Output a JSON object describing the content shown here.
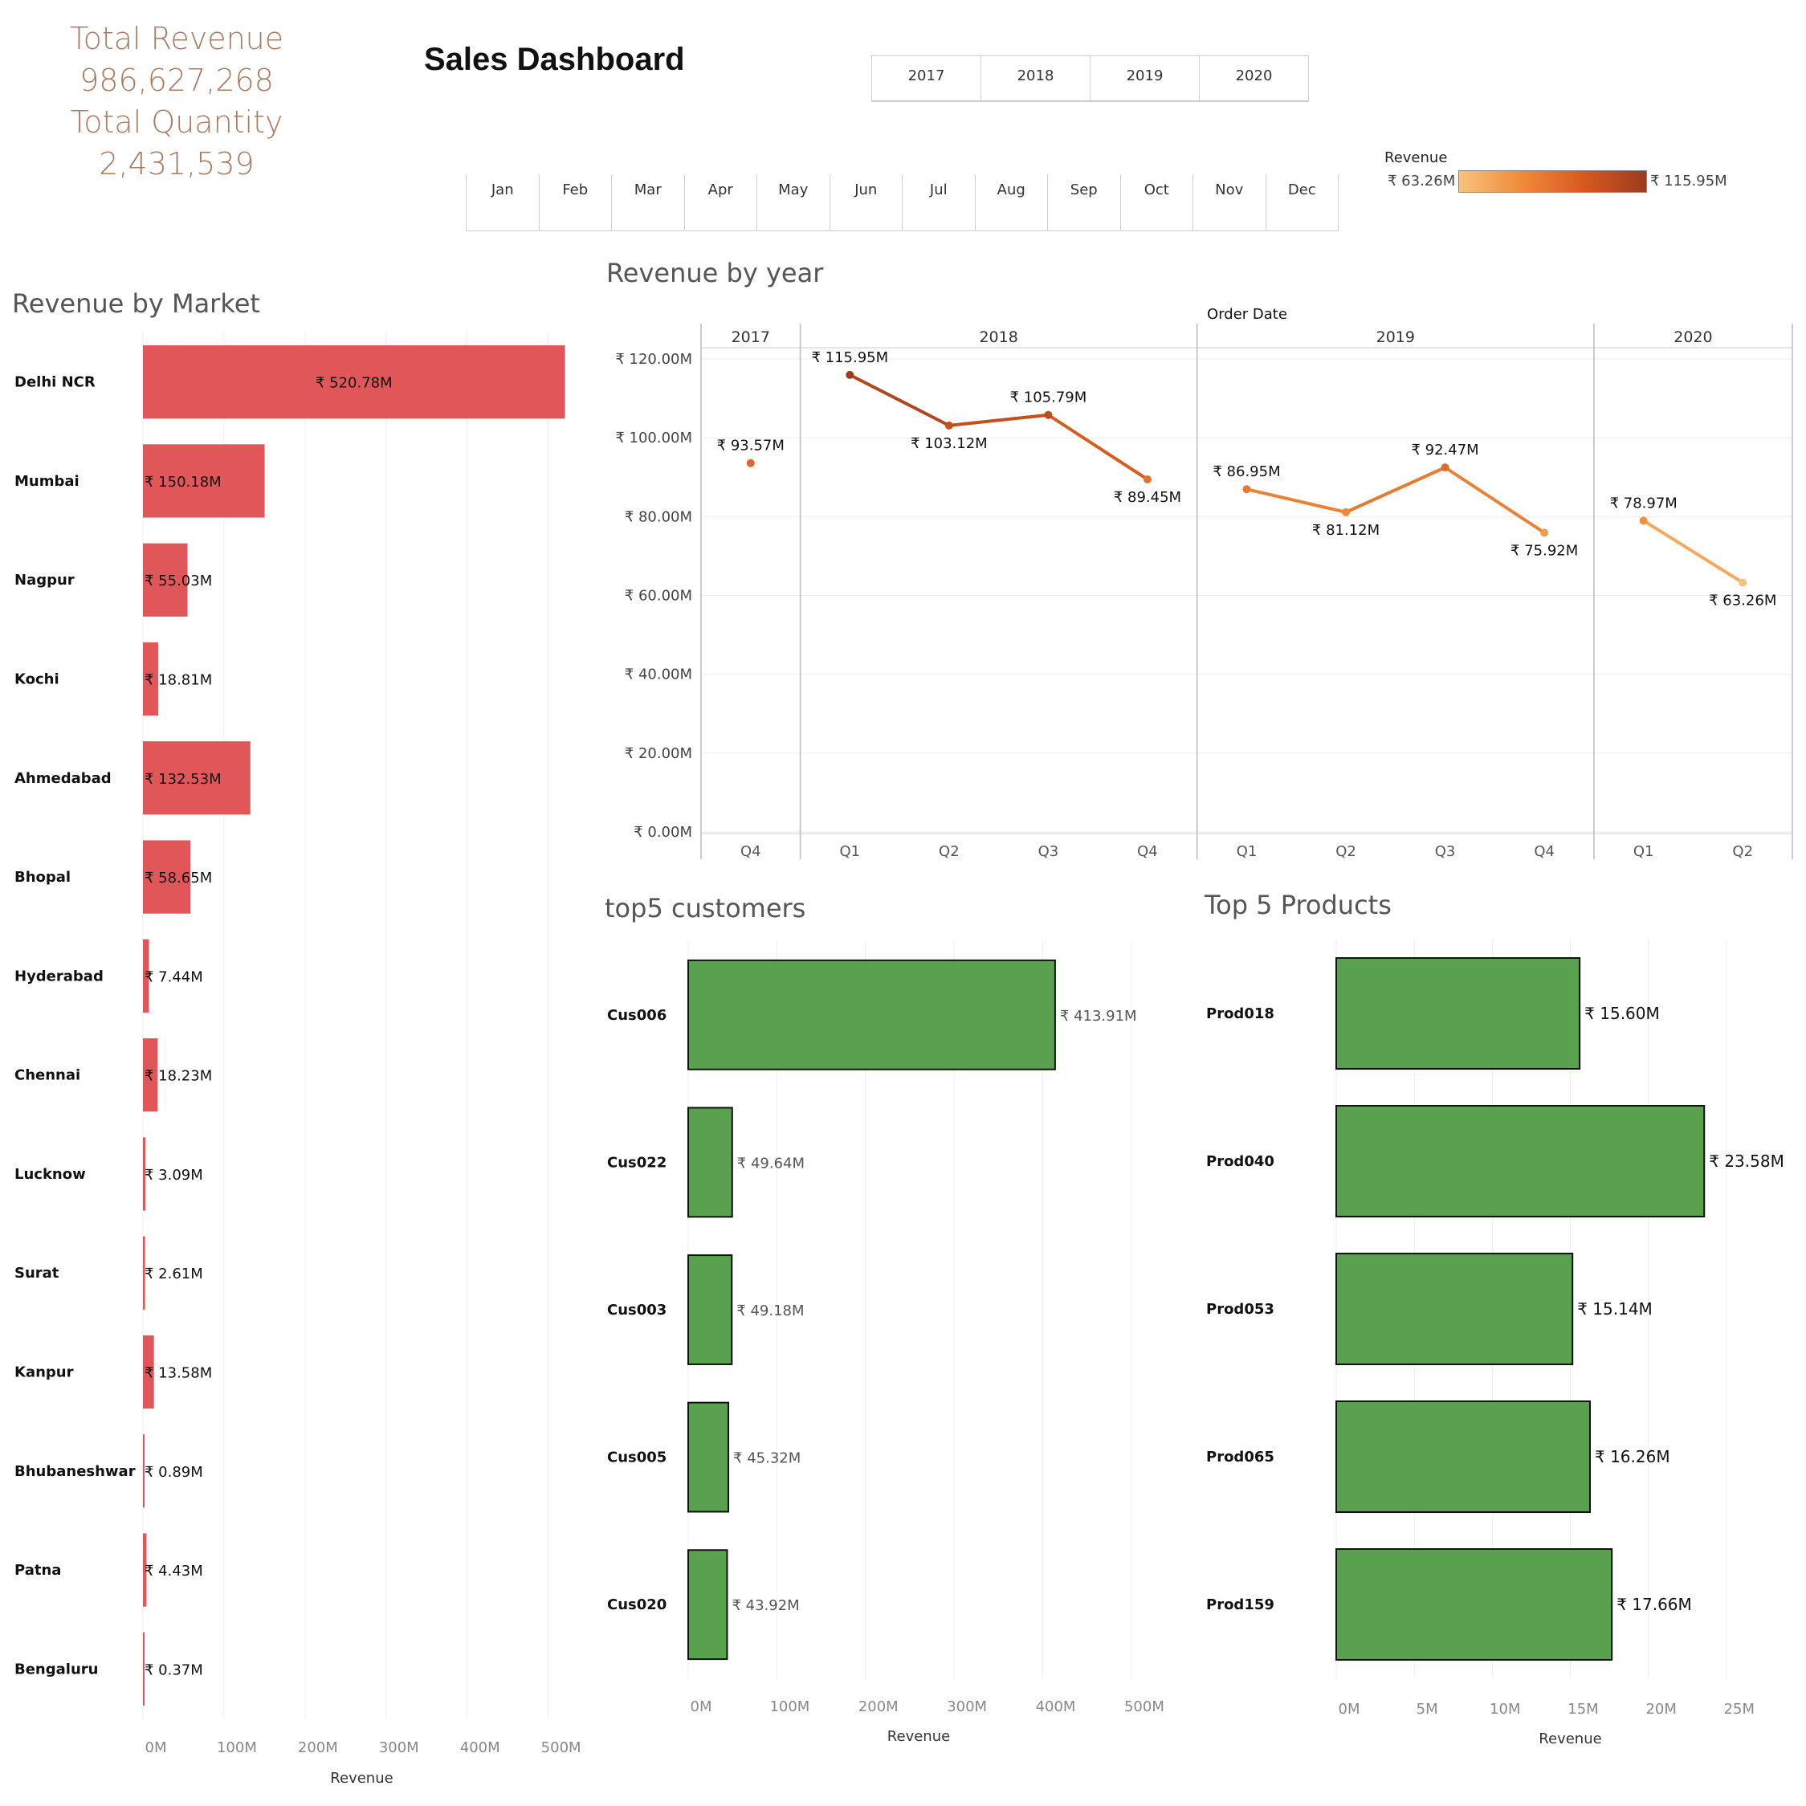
{
  "kpi": {
    "revenue_label": "Total Revenue",
    "revenue_value": "986,627,268",
    "quantity_label": "Total Quantity",
    "quantity_value": "2,431,539"
  },
  "title": "Sales Dashboard",
  "year_filter": [
    "2017",
    "2018",
    "2019",
    "2020"
  ],
  "month_filter": [
    "Jan",
    "Feb",
    "Mar",
    "Apr",
    "May",
    "Jun",
    "Jul",
    "Aug",
    "Sep",
    "Oct",
    "Nov",
    "Dec"
  ],
  "legend": {
    "title": "Revenue",
    "min": "₹ 63.26M",
    "max": "₹ 115.95M",
    "colors": [
      "#f9c27b",
      "#f08a3a",
      "#d65a1e",
      "#9e3a1e"
    ]
  },
  "chart_data": [
    {
      "type": "bar",
      "orientation": "horizontal",
      "title": "Revenue by Market",
      "xlabel": "Revenue",
      "categories": [
        "Delhi NCR",
        "Mumbai",
        "Nagpur",
        "Kochi",
        "Ahmedabad",
        "Bhopal",
        "Hyderabad",
        "Chennai",
        "Lucknow",
        "Surat",
        "Kanpur",
        "Bhubaneshwar",
        "Patna",
        "Bengaluru"
      ],
      "values": [
        520.78,
        150.18,
        55.03,
        18.81,
        132.53,
        58.65,
        7.44,
        18.23,
        3.09,
        2.61,
        13.58,
        0.89,
        4.43,
        0.37
      ],
      "labels": [
        "₹ 520.78M",
        "₹ 150.18M",
        "₹ 55.03M",
        "₹ 18.81M",
        "₹ 132.53M",
        "₹ 58.65M",
        "₹ 7.44M",
        "₹ 18.23M",
        "₹ 3.09M",
        "₹ 2.61M",
        "₹ 13.58M",
        "₹ 0.89M",
        "₹ 4.43M",
        "₹ 0.37M"
      ],
      "xticks": [
        "0M",
        "100M",
        "200M",
        "300M",
        "400M",
        "500M"
      ],
      "xlim": [
        0,
        540
      ],
      "color": "#e15759"
    },
    {
      "type": "line",
      "title": "Revenue by year",
      "header": "Order Date",
      "years": [
        {
          "year": "2017",
          "quarters": [
            "Q4"
          ],
          "values": [
            93.57
          ],
          "labels": [
            "₹ 93.57M"
          ]
        },
        {
          "year": "2018",
          "quarters": [
            "Q1",
            "Q2",
            "Q3",
            "Q4"
          ],
          "values": [
            115.95,
            103.12,
            105.79,
            89.45
          ],
          "labels": [
            "₹ 115.95M",
            "₹ 103.12M",
            "₹ 105.79M",
            "₹ 89.45M"
          ]
        },
        {
          "year": "2019",
          "quarters": [
            "Q1",
            "Q2",
            "Q3",
            "Q4"
          ],
          "values": [
            86.95,
            81.12,
            92.47,
            75.92
          ],
          "labels": [
            "₹ 86.95M",
            "₹ 81.12M",
            "₹ 92.47M",
            "₹ 75.92M"
          ]
        },
        {
          "year": "2020",
          "quarters": [
            "Q1",
            "Q2"
          ],
          "values": [
            78.97,
            63.26
          ],
          "labels": [
            "₹ 78.97M",
            "₹ 63.26M"
          ]
        }
      ],
      "yticks": [
        "₹ 0.00M",
        "₹ 20.00M",
        "₹ 40.00M",
        "₹ 60.00M",
        "₹ 80.00M",
        "₹ 100.00M",
        "₹ 120.00M"
      ],
      "ylim": [
        0,
        120
      ]
    },
    {
      "type": "bar",
      "orientation": "horizontal",
      "title": "top5 customers",
      "xlabel": "Revenue",
      "categories": [
        "Cus006",
        "Cus022",
        "Cus003",
        "Cus005",
        "Cus020"
      ],
      "values": [
        413.91,
        49.64,
        49.18,
        45.32,
        43.92
      ],
      "labels": [
        "₹ 413.91M",
        "₹ 49.64M",
        "₹ 49.18M",
        "₹ 45.32M",
        "₹ 43.92M"
      ],
      "xticks": [
        "0M",
        "100M",
        "200M",
        "300M",
        "400M",
        "500M"
      ],
      "xlim": [
        0,
        520
      ],
      "color": "#59a14f"
    },
    {
      "type": "bar",
      "orientation": "horizontal",
      "title": "Top 5 Products",
      "xlabel": "Revenue",
      "categories": [
        "Prod018",
        "Prod040",
        "Prod053",
        "Prod065",
        "Prod159"
      ],
      "values": [
        15.6,
        23.58,
        15.14,
        16.26,
        17.66
      ],
      "labels": [
        "₹ 15.60M",
        "₹ 23.58M",
        "₹ 15.14M",
        "₹ 16.26M",
        "₹ 17.66M"
      ],
      "xticks": [
        "0M",
        "5M",
        "10M",
        "15M",
        "20M",
        "25M"
      ],
      "xlim": [
        0,
        30
      ],
      "color": "#59a14f"
    }
  ]
}
